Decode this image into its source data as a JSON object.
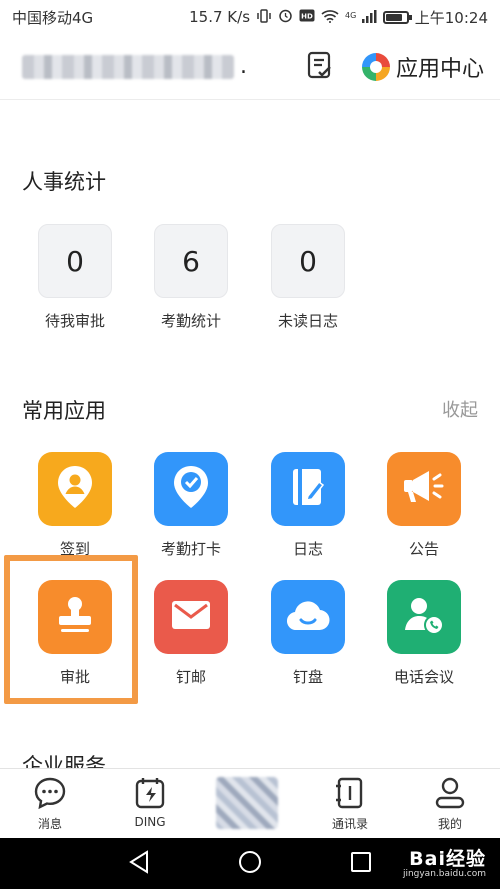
{
  "status_bar": {
    "carrier": "中国移动4G",
    "speed": "15.7 K/s",
    "network": "4G",
    "time": "上午10:24",
    "battery_level": 0.8
  },
  "header": {
    "app_center_label": "应用中心"
  },
  "stats": {
    "title": "人事统计",
    "items": [
      {
        "value": "0",
        "label": "待我审批"
      },
      {
        "value": "6",
        "label": "考勤统计"
      },
      {
        "value": "0",
        "label": "未读日志"
      }
    ]
  },
  "common_apps": {
    "title": "常用应用",
    "collapse_label": "收起",
    "items": [
      {
        "label": "签到",
        "icon": "location-pin-icon",
        "color": "#f7a91d"
      },
      {
        "label": "考勤打卡",
        "icon": "checkin-pin-icon",
        "color": "#3296fa"
      },
      {
        "label": "日志",
        "icon": "notebook-pen-icon",
        "color": "#3296fa"
      },
      {
        "label": "公告",
        "icon": "megaphone-icon",
        "color": "#f78c2c"
      },
      {
        "label": "审批",
        "icon": "stamp-icon",
        "color": "#f78c2c"
      },
      {
        "label": "钉邮",
        "icon": "envelope-icon",
        "color": "#ea5a4b"
      },
      {
        "label": "钉盘",
        "icon": "cloud-icon",
        "color": "#3296fa"
      },
      {
        "label": "电话会议",
        "icon": "contact-phone-icon",
        "color": "#1faf73"
      }
    ]
  },
  "enterprise": {
    "title": "企业服务"
  },
  "bottom_nav": [
    {
      "label": "消息",
      "icon": "chat-bubble-icon"
    },
    {
      "label": "DING",
      "icon": "ding-bolt-icon"
    },
    {
      "label": "通讯录",
      "icon": "contacts-book-icon"
    },
    {
      "label": "我的",
      "icon": "person-icon"
    }
  ],
  "watermark": {
    "main": "Bai经验",
    "sub": "jingyan.baidu.com"
  },
  "highlight_color": "#f39a45"
}
